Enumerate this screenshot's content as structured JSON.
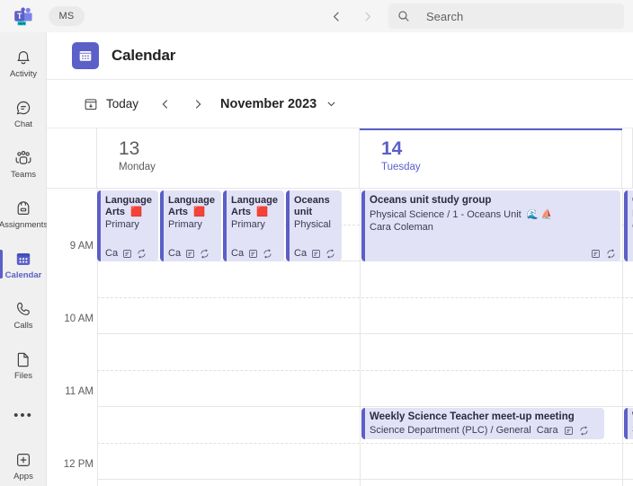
{
  "titlebar": {
    "logo_icon": "teams-logo-icon",
    "logo_badge": "NEW",
    "avatar_initials": "MS",
    "back_icon": "chevron-left-icon",
    "forward_icon": "chevron-right-icon",
    "search": {
      "icon": "search-icon",
      "placeholder": "Search",
      "value": ""
    }
  },
  "rail": {
    "items": [
      {
        "label": "Activity",
        "icon": "bell-icon",
        "active": false
      },
      {
        "label": "Chat",
        "icon": "chat-icon",
        "active": false
      },
      {
        "label": "Teams",
        "icon": "teams-icon",
        "active": false
      },
      {
        "label": "Assignments",
        "icon": "backpack-icon",
        "active": false
      },
      {
        "label": "Calendar",
        "icon": "calendar-icon",
        "active": true
      },
      {
        "label": "Calls",
        "icon": "phone-icon",
        "active": false
      },
      {
        "label": "Files",
        "icon": "file-icon",
        "active": false
      }
    ],
    "more_label": "•••",
    "apps": {
      "label": "Apps",
      "icon": "apps-plus-icon"
    }
  },
  "page": {
    "title": "Calendar",
    "icon": "calendar-app-icon"
  },
  "toolbar": {
    "today_label": "Today",
    "today_icon": "today-calendar-icon",
    "prev_icon": "chevron-left-icon",
    "next_icon": "chevron-right-icon",
    "month_label": "November 2023",
    "month_chevron_icon": "chevron-down-icon"
  },
  "calendar": {
    "hours": [
      "9 AM",
      "10 AM",
      "11 AM",
      "12 PM"
    ],
    "days": [
      {
        "number": "13",
        "name": "Monday",
        "today": false
      },
      {
        "number": "14",
        "name": "Tuesday",
        "today": true
      },
      {
        "number": "",
        "name": "",
        "today": false
      }
    ],
    "events": [
      {
        "id": "mon-la-1",
        "day": 0,
        "style": "narrow",
        "title": "Language",
        "title2": "Arts",
        "title_emoji": "🟥",
        "sub": "Primary",
        "organizer": "Ca",
        "icons": [
          "notes-icon",
          "recurring-icon"
        ]
      },
      {
        "id": "mon-la-2",
        "day": 0,
        "style": "narrow",
        "title": "Language",
        "title2": "Arts",
        "title_emoji": "🟥",
        "sub": "Primary",
        "organizer": "Ca",
        "icons": [
          "notes-icon",
          "recurring-icon"
        ]
      },
      {
        "id": "mon-la-3",
        "day": 0,
        "style": "narrow",
        "title": "Language",
        "title2": "Arts",
        "title_emoji": "🟥",
        "sub": "Primary",
        "organizer": "Ca",
        "icons": [
          "notes-icon",
          "recurring-icon"
        ]
      },
      {
        "id": "mon-oceans",
        "day": 0,
        "style": "narrow",
        "title": "Oceans",
        "title2": "unit",
        "title_emoji": "",
        "sub": "Physical",
        "organizer": "Ca",
        "icons": [
          "notes-icon",
          "recurring-icon"
        ]
      },
      {
        "id": "tue-oceans-study",
        "day": 1,
        "style": "wide",
        "title": "Oceans unit study group",
        "sub": "Physical Science / 1 - Oceans Unit",
        "sub_emoji": "🌊 ⛵",
        "organizer": "Cara Coleman",
        "icons": [
          "notes-icon",
          "recurring-icon"
        ]
      },
      {
        "id": "tue-weekly-science",
        "day": 1,
        "style": "wide-short",
        "title": "Weekly Science Teacher meet-up meeting",
        "sub": "Science Department (PLC) / General",
        "organizer": "Cara",
        "icons": [
          "notes-icon",
          "recurring-icon"
        ]
      },
      {
        "id": "wed-oceans-clip",
        "day": 2,
        "style": "clipped",
        "title": "O",
        "sub": "P",
        "organizer": "C",
        "icons": []
      },
      {
        "id": "wed-weekly-clip",
        "day": 2,
        "style": "clipped-short",
        "title": "W",
        "sub": "S",
        "organizer": "",
        "icons": []
      }
    ]
  },
  "colors": {
    "accent": "#5b5fc7",
    "event_bg": "#e2e2f6",
    "event_bar": "#5b5fc7",
    "rail_bg": "#f0f0f0",
    "grid_line": "#e6e6e6"
  }
}
